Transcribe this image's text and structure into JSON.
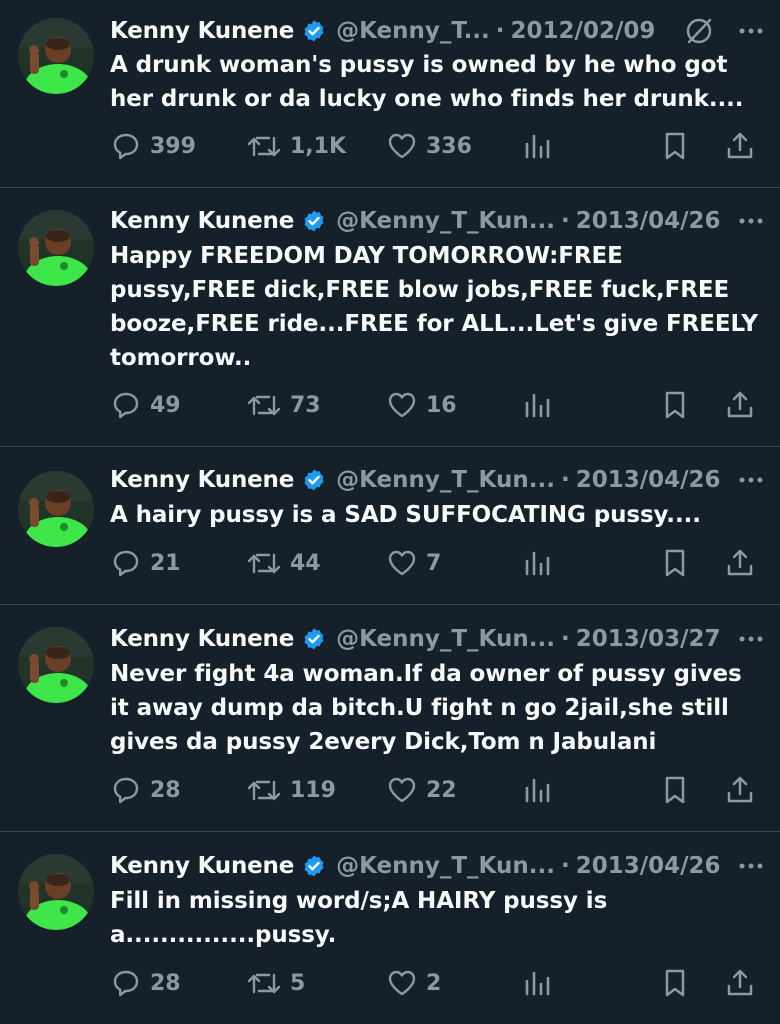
{
  "colors": {
    "background": "#15202b",
    "text": "#f7f9f9",
    "secondary": "#8b98a5",
    "verified": "#1d9bf0",
    "divider": "#38444d"
  },
  "icons": {
    "reply": "reply-icon",
    "retweet": "retweet-icon",
    "like": "heart-icon",
    "views": "analytics-icon",
    "bookmark": "bookmark-icon",
    "share": "share-icon",
    "more": "more-icon",
    "grok": "grok-icon",
    "verified": "verified-badge-icon"
  },
  "tweets": [
    {
      "name": "Kenny Kunene",
      "handle": "@Kenny_T...",
      "date": "2012/02/09",
      "text": "A drunk woman's pussy is owned by he who got her drunk or da lucky one who finds her drunk....",
      "replies": "399",
      "retweets": "1,1K",
      "likes": "336"
    },
    {
      "name": "Kenny Kunene",
      "handle": "@Kenny_T_Kun...",
      "date": "2013/04/26",
      "text": "Happy FREEDOM DAY TOMORROW:FREE pussy,FREE dick,FREE blow jobs,FREE fuck,FREE booze,FREE ride...FREE for ALL...Let's give FREELY tomorrow..",
      "replies": "49",
      "retweets": "73",
      "likes": "16"
    },
    {
      "name": "Kenny Kunene",
      "handle": "@Kenny_T_Kun...",
      "date": "2013/04/26",
      "text": "A hairy pussy is a SAD SUFFOCATING pussy....",
      "replies": "21",
      "retweets": "44",
      "likes": "7"
    },
    {
      "name": "Kenny Kunene",
      "handle": "@Kenny_T_Kun...",
      "date": "2013/03/27",
      "text": "Never fight 4a woman.If da owner of pussy gives it away dump da bitch.U fight n go 2jail,she still gives da pussy 2every Dick,Tom n Jabulani",
      "replies": "28",
      "retweets": "119",
      "likes": "22"
    },
    {
      "name": "Kenny Kunene",
      "handle": "@Kenny_T_Kun...",
      "date": "2013/04/26",
      "text": "Fill in missing word/s;A HAIRY pussy is a...............pussy.",
      "replies": "28",
      "retweets": "5",
      "likes": "2"
    }
  ]
}
